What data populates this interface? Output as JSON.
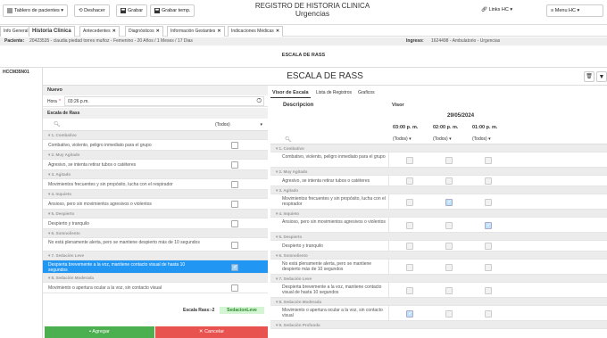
{
  "toolbar": {
    "tablero": "Tablero de pacientes",
    "deshacer": "Deshacer",
    "grabar": "Grabar",
    "grabar_temp": "Grabar temp.",
    "title1": "REGISTRO DE HISTORIA CLINICA",
    "title2": "Urgencias",
    "links": "Links HC",
    "menu": "Menu HC"
  },
  "tabs": [
    {
      "label": "Info General"
    },
    {
      "label": "Historia Clinica"
    },
    {
      "label": "Antecedentes"
    },
    {
      "label": "Diagnósticos"
    },
    {
      "label": "Información Gestantes"
    },
    {
      "label": "Indicaciones Médicas"
    }
  ],
  "patient": {
    "label": "Paciente:",
    "value": "20423535 - claudia piedad torres muñoz - Femenino - 20 Años / 1 Meses / 17 Dias",
    "ingreso_label": "Ingreso:",
    "ingreso_value": "1624498 - Ambulatorio - Urgencias"
  },
  "section": {
    "header": "ESCALA DE RASS",
    "code": "HCCM35N01",
    "title": "ESCALA DE RASS"
  },
  "left": {
    "nuevo": "Nuevo",
    "hora_label": "Hora",
    "hora_value": "03:26 p.m.",
    "escala_label": "Escala de Rass",
    "filter": "(Todos)",
    "score_label": "Escala Rass:",
    "score_value": "-2",
    "score_badge": "SedacionLeve",
    "agregar": "Agregar",
    "cancelar": "Cancelar"
  },
  "left_rows": [
    {
      "t": "g",
      "text": "1. Combativo"
    },
    {
      "t": "i",
      "text": "Combativo, violento, peligro inmediato para el grupo"
    },
    {
      "t": "g",
      "text": "2. Muy Agitado"
    },
    {
      "t": "i",
      "text": "Agresivo, se intenta retirar tubos o catéteres"
    },
    {
      "t": "g",
      "text": "3. Agitado"
    },
    {
      "t": "i",
      "text": "Movimientos frecuentes y sin propósito, lucha con el respirador"
    },
    {
      "t": "g",
      "text": "4. Inquieto"
    },
    {
      "t": "i",
      "text": "Ansioso, pero sin movimientos agresivos o violentos"
    },
    {
      "t": "g",
      "text": "5. Despierto"
    },
    {
      "t": "i",
      "text": "Despierto y tranquilo"
    },
    {
      "t": "g",
      "text": "6. Somnoliento"
    },
    {
      "t": "i2",
      "text": "No está plenamente alerta, pero se mantiene despierto más de 10 segundos"
    },
    {
      "t": "g",
      "text": "7. Sedación Leve"
    },
    {
      "t": "s",
      "text": "Despierta brevemente a la voz, mantiene contacto visual de hasta 10 segundos"
    },
    {
      "t": "g",
      "text": "8. Sedación Moderada"
    },
    {
      "t": "i",
      "text": "Movimiento o apertura ocular a la voz, sin contacto visual"
    }
  ],
  "right": {
    "tabs": [
      "Visor de Escala",
      "Lista de Registros",
      "Graficos"
    ],
    "desc_header": "Descripcion",
    "visor_header": "Visor",
    "date": "29/05/2024",
    "times": [
      "03:00 p. m.",
      "02:00 p. m.",
      "01:00 p. m."
    ],
    "filter": "(Todos)"
  },
  "right_rows": [
    {
      "t": "g",
      "text": "1. Combativo"
    },
    {
      "t": "i2",
      "text": "Combativo, violento, peligro inmediato para el grupo",
      "c": [
        0,
        0,
        0
      ]
    },
    {
      "t": "g",
      "text": "2. Muy Agitado"
    },
    {
      "t": "i",
      "text": "Agresivo, se intenta retirar tubos o catéteres",
      "c": [
        0,
        0,
        0
      ]
    },
    {
      "t": "g",
      "text": "3. Agitado"
    },
    {
      "t": "i2",
      "text": "Movimientos frecuentes y sin propósito, lucha con el respirador",
      "c": [
        0,
        1,
        0
      ]
    },
    {
      "t": "g",
      "text": "4. Inquieto"
    },
    {
      "t": "i2",
      "text": "Ansioso, pero sin movimientos agresivos o violentos",
      "c": [
        0,
        0,
        1
      ]
    },
    {
      "t": "g",
      "text": "5. Despierto"
    },
    {
      "t": "i",
      "text": "Despierto y tranquilo",
      "c": [
        0,
        0,
        0
      ]
    },
    {
      "t": "g",
      "text": "6. Somnoliento"
    },
    {
      "t": "i2",
      "text": "No está plenamente alerta, pero se mantiene despierto más de 10 segundos",
      "c": [
        0,
        0,
        0
      ]
    },
    {
      "t": "g",
      "text": "7. Sedación Leve"
    },
    {
      "t": "i2",
      "text": "Despierta brevemente a la voz, mantiene contacto visual de hasta 10 segundos",
      "c": [
        0,
        0,
        0
      ]
    },
    {
      "t": "g",
      "text": "8. Sedación Moderada"
    },
    {
      "t": "i2",
      "text": "Movimiento o apertura ocular a la voz, sin contacto visual",
      "c": [
        1,
        0,
        0
      ]
    },
    {
      "t": "g",
      "text": "9. Sedación Profunda"
    }
  ]
}
